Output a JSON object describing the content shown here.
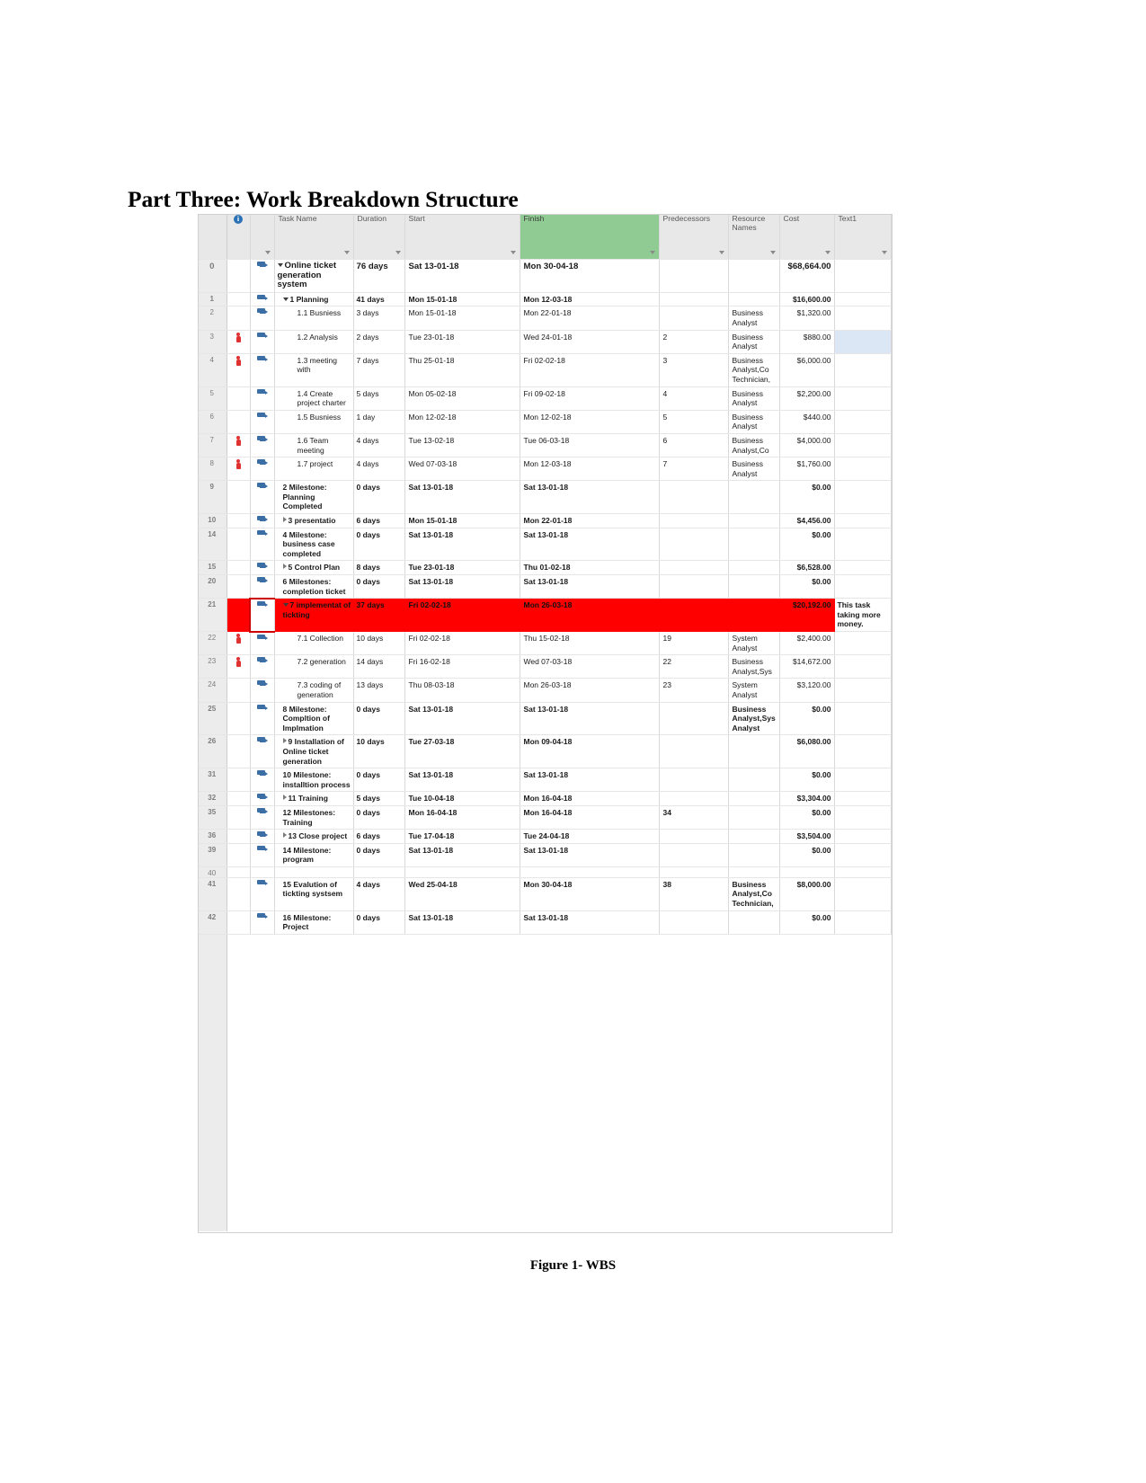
{
  "document": {
    "title": "Part Three: Work Breakdown Structure",
    "figure_caption": "Figure 1- WBS"
  },
  "grid": {
    "headers": {
      "row_number": "",
      "indicators": "i",
      "task_mode": "",
      "task_name": "Task Name",
      "duration": "Duration",
      "start": "Start",
      "finish": "Finish",
      "predecessors": "Predecessors",
      "resource_names": "Resource Names",
      "cost": "Cost",
      "text1": "Text1"
    },
    "highlight_color": "#ff0000",
    "finish_header_color": "#8fcb92",
    "rows": [
      {
        "num": "0",
        "indicator": "",
        "level": 0,
        "twisty": "down",
        "bold": true,
        "summary": true,
        "name": "Online ticket generation system",
        "duration": "76 days",
        "start": "Sat 13-01-18",
        "finish": "Mon 30-04-18",
        "predecessors": "",
        "resources": "",
        "cost": "$68,664.00",
        "text1": ""
      },
      {
        "num": "1",
        "indicator": "",
        "level": 1,
        "twisty": "down",
        "bold": true,
        "summary": false,
        "name": "1 Planning",
        "duration": "41 days",
        "start": "Mon 15-01-18",
        "finish": "Mon 12-03-18",
        "predecessors": "",
        "resources": "",
        "cost": "$16,600.00",
        "text1": ""
      },
      {
        "num": "2",
        "indicator": "",
        "level": 2,
        "twisty": "",
        "bold": false,
        "summary": false,
        "name": "1.1 Busniess",
        "duration": "3 days",
        "start": "Mon 15-01-18",
        "finish": "Mon 22-01-18",
        "predecessors": "",
        "resources": "Business Analyst",
        "cost": "$1,320.00",
        "text1": ""
      },
      {
        "num": "3",
        "indicator": "person",
        "level": 2,
        "twisty": "",
        "bold": false,
        "summary": false,
        "name": "1.2 Analysis",
        "duration": "2 days",
        "start": "Tue 23-01-18",
        "finish": "Wed 24-01-18",
        "predecessors": "2",
        "resources": "Business Analyst",
        "cost": "$880.00",
        "text1": "",
        "text1_selected": true
      },
      {
        "num": "4",
        "indicator": "person",
        "level": 2,
        "twisty": "",
        "bold": false,
        "summary": false,
        "name": "1.3 meeting with",
        "duration": "7 days",
        "start": "Thu 25-01-18",
        "finish": "Fri 02-02-18",
        "predecessors": "3",
        "resources": "Business Analyst,Co Technician,",
        "cost": "$6,000.00",
        "text1": ""
      },
      {
        "num": "5",
        "indicator": "",
        "level": 2,
        "twisty": "",
        "bold": false,
        "summary": false,
        "name": "1.4 Create project charter",
        "duration": "5 days",
        "start": "Mon 05-02-18",
        "finish": "Fri 09-02-18",
        "predecessors": "4",
        "resources": "Business Analyst",
        "cost": "$2,200.00",
        "text1": ""
      },
      {
        "num": "6",
        "indicator": "",
        "level": 2,
        "twisty": "",
        "bold": false,
        "summary": false,
        "name": "1.5 Busniess",
        "duration": "1 day",
        "start": "Mon 12-02-18",
        "finish": "Mon 12-02-18",
        "predecessors": "5",
        "resources": "Business Analyst",
        "cost": "$440.00",
        "text1": ""
      },
      {
        "num": "7",
        "indicator": "person",
        "level": 2,
        "twisty": "",
        "bold": false,
        "summary": false,
        "name": "1.6 Team meeting",
        "duration": "4 days",
        "start": "Tue 13-02-18",
        "finish": "Tue 06-03-18",
        "predecessors": "6",
        "resources": "Business Analyst,Co",
        "cost": "$4,000.00",
        "text1": ""
      },
      {
        "num": "8",
        "indicator": "person",
        "level": 2,
        "twisty": "",
        "bold": false,
        "summary": false,
        "name": "1.7 project",
        "duration": "4 days",
        "start": "Wed 07-03-18",
        "finish": "Mon 12-03-18",
        "predecessors": "7",
        "resources": "Business Analyst",
        "cost": "$1,760.00",
        "text1": ""
      },
      {
        "num": "9",
        "indicator": "",
        "level": 1,
        "twisty": "",
        "bold": true,
        "summary": false,
        "name": "2 Milestone: Planning Completed",
        "duration": "0 days",
        "start": "Sat 13-01-18",
        "finish": "Sat 13-01-18",
        "predecessors": "",
        "resources": "",
        "cost": "$0.00",
        "text1": ""
      },
      {
        "num": "10",
        "indicator": "",
        "level": 1,
        "twisty": "right",
        "bold": true,
        "summary": false,
        "name": "3 presentatio",
        "duration": "6 days",
        "start": "Mon 15-01-18",
        "finish": "Mon 22-01-18",
        "predecessors": "",
        "resources": "",
        "cost": "$4,456.00",
        "text1": ""
      },
      {
        "num": "14",
        "indicator": "",
        "level": 1,
        "twisty": "",
        "bold": true,
        "summary": false,
        "name": "4 Milestone: business case completed",
        "duration": "0 days",
        "start": "Sat 13-01-18",
        "finish": "Sat 13-01-18",
        "predecessors": "",
        "resources": "",
        "cost": "$0.00",
        "text1": ""
      },
      {
        "num": "15",
        "indicator": "",
        "level": 1,
        "twisty": "right",
        "bold": true,
        "summary": false,
        "name": "5 Control Plan",
        "duration": "8 days",
        "start": "Tue 23-01-18",
        "finish": "Thu 01-02-18",
        "predecessors": "",
        "resources": "",
        "cost": "$6,528.00",
        "text1": ""
      },
      {
        "num": "20",
        "indicator": "",
        "level": 1,
        "twisty": "",
        "bold": true,
        "summary": false,
        "name": "6 Milestones: completion ticket",
        "duration": "0 days",
        "start": "Sat 13-01-18",
        "finish": "Sat 13-01-18",
        "predecessors": "",
        "resources": "",
        "cost": "$0.00",
        "text1": ""
      },
      {
        "num": "21",
        "indicator": "",
        "level": 1,
        "twisty": "down",
        "bold": true,
        "summary": false,
        "flagged": true,
        "name": "7 implementat of tickting",
        "duration": "37 days",
        "start": "Fri 02-02-18",
        "finish": "Mon 26-03-18",
        "predecessors": "",
        "resources": "",
        "cost": "$20,192.00",
        "text1": "This task taking more money."
      },
      {
        "num": "22",
        "indicator": "person",
        "level": 2,
        "twisty": "",
        "bold": false,
        "summary": false,
        "name": "7.1 Collection",
        "duration": "10 days",
        "start": "Fri 02-02-18",
        "finish": "Thu 15-02-18",
        "predecessors": "19",
        "resources": "System Analyst",
        "cost": "$2,400.00",
        "text1": ""
      },
      {
        "num": "23",
        "indicator": "person",
        "level": 2,
        "twisty": "",
        "bold": false,
        "summary": false,
        "name": "7.2 generation",
        "duration": "14 days",
        "start": "Fri 16-02-18",
        "finish": "Wed 07-03-18",
        "predecessors": "22",
        "resources": "Business Analyst,Sys",
        "cost": "$14,672.00",
        "text1": ""
      },
      {
        "num": "24",
        "indicator": "",
        "level": 2,
        "twisty": "",
        "bold": false,
        "summary": false,
        "name": "7.3 coding of generation",
        "duration": "13 days",
        "start": "Thu 08-03-18",
        "finish": "Mon 26-03-18",
        "predecessors": "23",
        "resources": "System Analyst",
        "cost": "$3,120.00",
        "text1": ""
      },
      {
        "num": "25",
        "indicator": "",
        "level": 1,
        "twisty": "",
        "bold": true,
        "summary": false,
        "name": "8 Milestone: Compltion of Implmation",
        "duration": "0 days",
        "start": "Sat 13-01-18",
        "finish": "Sat 13-01-18",
        "predecessors": "",
        "resources": "Business Analyst,Sys Analyst",
        "cost": "$0.00",
        "text1": ""
      },
      {
        "num": "26",
        "indicator": "",
        "level": 1,
        "twisty": "right",
        "bold": true,
        "summary": false,
        "name": "9 Installation of Online ticket generation",
        "duration": "10 days",
        "start": "Tue 27-03-18",
        "finish": "Mon 09-04-18",
        "predecessors": "",
        "resources": "",
        "cost": "$6,080.00",
        "text1": ""
      },
      {
        "num": "31",
        "indicator": "",
        "level": 1,
        "twisty": "",
        "bold": true,
        "summary": false,
        "name": "10 Milestone: installtion process",
        "duration": "0 days",
        "start": "Sat 13-01-18",
        "finish": "Sat 13-01-18",
        "predecessors": "",
        "resources": "",
        "cost": "$0.00",
        "text1": ""
      },
      {
        "num": "32",
        "indicator": "",
        "level": 1,
        "twisty": "right",
        "bold": true,
        "summary": false,
        "name": "11 Training",
        "duration": "5 days",
        "start": "Tue 10-04-18",
        "finish": "Mon 16-04-18",
        "predecessors": "",
        "resources": "",
        "cost": "$3,304.00",
        "text1": ""
      },
      {
        "num": "35",
        "indicator": "",
        "level": 1,
        "twisty": "",
        "bold": true,
        "summary": false,
        "name": "12 Milestones: Training",
        "duration": "0 days",
        "start": "Mon 16-04-18",
        "finish": "Mon 16-04-18",
        "predecessors": "34",
        "resources": "",
        "cost": "$0.00",
        "text1": ""
      },
      {
        "num": "36",
        "indicator": "",
        "level": 1,
        "twisty": "right",
        "bold": true,
        "summary": false,
        "name": "13 Close project",
        "duration": "6 days",
        "start": "Tue 17-04-18",
        "finish": "Tue 24-04-18",
        "predecessors": "",
        "resources": "",
        "cost": "$3,504.00",
        "text1": ""
      },
      {
        "num": "39",
        "indicator": "",
        "level": 1,
        "twisty": "",
        "bold": true,
        "summary": false,
        "name": "14 Milestone: program",
        "duration": "0 days",
        "start": "Sat 13-01-18",
        "finish": "Sat 13-01-18",
        "predecessors": "",
        "resources": "",
        "cost": "$0.00",
        "text1": ""
      },
      {
        "num": "40",
        "indicator": "",
        "level": 1,
        "twisty": "",
        "bold": false,
        "summary": false,
        "empty": true,
        "name": "",
        "duration": "",
        "start": "",
        "finish": "",
        "predecessors": "",
        "resources": "",
        "cost": "",
        "text1": ""
      },
      {
        "num": "41",
        "indicator": "",
        "level": 1,
        "twisty": "",
        "bold": true,
        "summary": false,
        "name": "15 Evalution of tickting systsem",
        "duration": "4 days",
        "start": "Wed 25-04-18",
        "finish": "Mon 30-04-18",
        "predecessors": "38",
        "resources": "Business Analyst,Co Technician,",
        "cost": "$8,000.00",
        "text1": ""
      },
      {
        "num": "42",
        "indicator": "",
        "level": 1,
        "twisty": "",
        "bold": true,
        "summary": false,
        "name": "16 Milestone: Project",
        "duration": "0 days",
        "start": "Sat 13-01-18",
        "finish": "Sat 13-01-18",
        "predecessors": "",
        "resources": "",
        "cost": "$0.00",
        "text1": ""
      }
    ]
  }
}
